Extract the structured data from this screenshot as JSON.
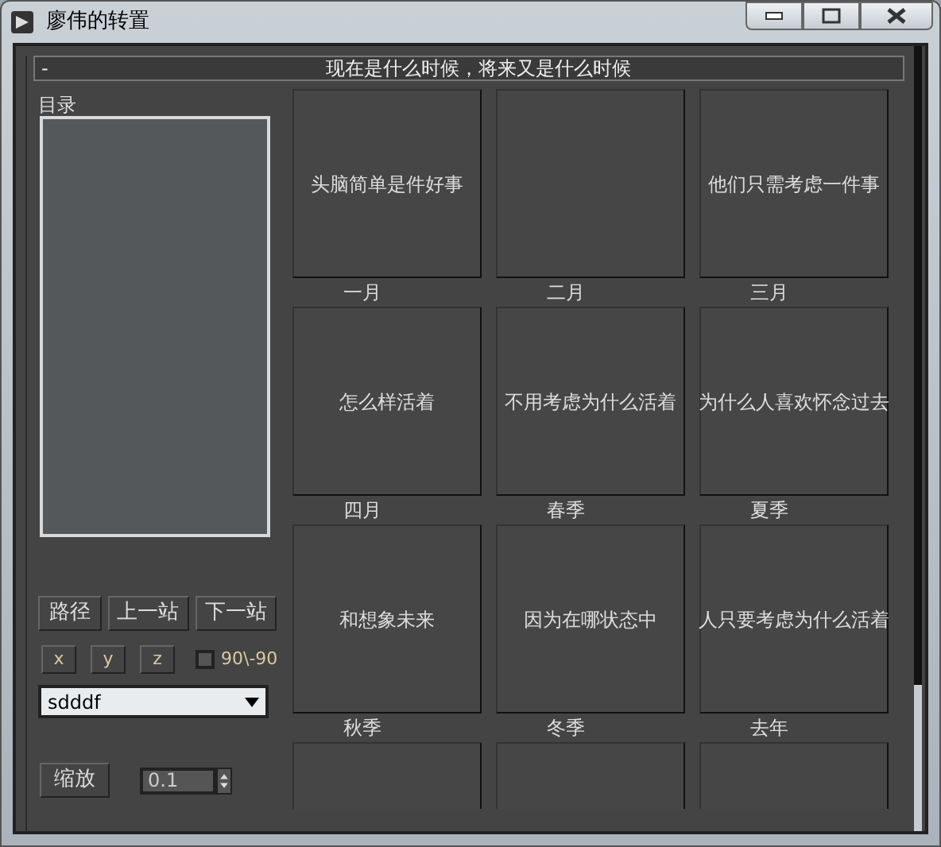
{
  "window": {
    "title": "廖伟的转置"
  },
  "rollout": {
    "collapse": "-",
    "title": "现在是什么时候，将来又是什么时候"
  },
  "list": {
    "label": "目录"
  },
  "nav_buttons": [
    "路径",
    "上一站",
    "下一站"
  ],
  "axis_buttons": [
    "x",
    "y",
    "z"
  ],
  "checkbox": {
    "label": "90\\-90",
    "checked": false
  },
  "dropdown": {
    "value": "sdddf"
  },
  "zoom": {
    "button": "缩放",
    "value": "0.1"
  },
  "tiles": [
    {
      "text": "头脑简单是件好事",
      "caption": "一月"
    },
    {
      "caption": "二月"
    },
    {
      "text": "他们只需考虑一件事",
      "caption": "三月"
    },
    {
      "text": "怎么样活着",
      "caption": "四月"
    },
    {
      "text": "不用考虑为什么活着",
      "caption": "春季"
    },
    {
      "text": "为什么人喜欢怀念过去",
      "caption": "夏季"
    },
    {
      "text": "和想象未来",
      "caption": "秋季"
    },
    {
      "text": "因为在哪状态中",
      "caption": "冬季"
    },
    {
      "text": "人只要考虑为什么活着",
      "caption": "去年"
    },
    {
      "kind": "cut"
    },
    {
      "kind": "cut"
    },
    {
      "kind": "cut"
    }
  ]
}
